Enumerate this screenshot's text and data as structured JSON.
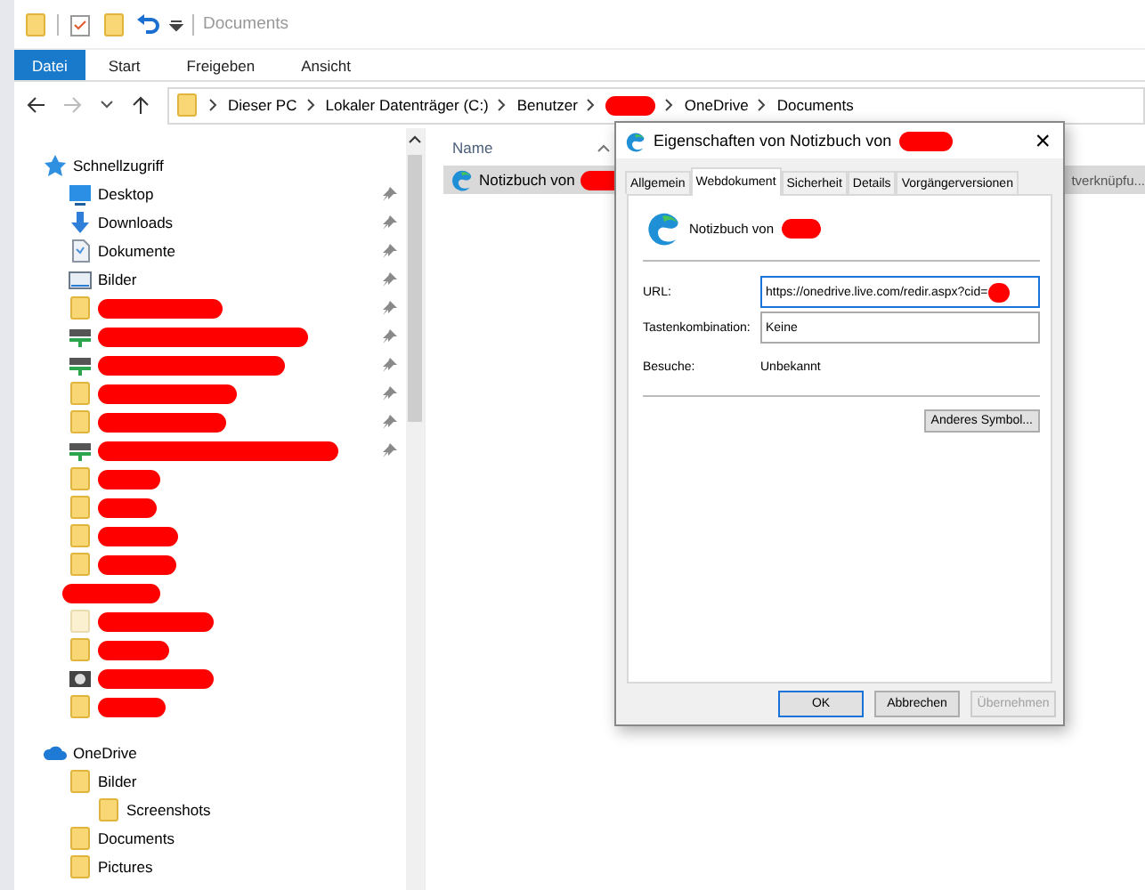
{
  "window": {
    "title": "Documents"
  },
  "ribbon_tabs": [
    {
      "label": "Datei",
      "selected": true
    },
    {
      "label": "Start",
      "selected": false
    },
    {
      "label": "Freigeben",
      "selected": false
    },
    {
      "label": "Ansicht",
      "selected": false
    }
  ],
  "address": {
    "crumbs": [
      {
        "label": "Dieser PC"
      },
      {
        "label": "Lokaler Datenträger (C:)"
      },
      {
        "label": "Benutzer"
      },
      {
        "redacted": true
      },
      {
        "label": "OneDrive"
      },
      {
        "label": "Documents"
      }
    ]
  },
  "nav": {
    "quick_access": {
      "label": "Schnellzugriff",
      "items": [
        {
          "label": "Desktop",
          "kind": "desktop",
          "pinned": true
        },
        {
          "label": "Downloads",
          "kind": "downloads",
          "pinned": true
        },
        {
          "label": "Dokumente",
          "kind": "documents",
          "pinned": true
        },
        {
          "label": "Bilder",
          "kind": "pictures",
          "pinned": true
        },
        {
          "kind": "folder",
          "pinned": true,
          "redacted": true
        },
        {
          "kind": "network",
          "pinned": true,
          "redacted": true
        },
        {
          "kind": "network",
          "pinned": true,
          "redacted": true
        },
        {
          "kind": "folder",
          "pinned": true,
          "redacted": true
        },
        {
          "kind": "folder",
          "pinned": true,
          "redacted": true
        },
        {
          "kind": "network",
          "pinned": true,
          "redacted": true
        },
        {
          "kind": "folder",
          "pinned": false,
          "redacted": true
        },
        {
          "kind": "folder",
          "pinned": false,
          "redacted": true
        },
        {
          "kind": "folder",
          "pinned": false,
          "redacted": true
        },
        {
          "kind": "folder",
          "pinned": false,
          "redacted": true
        },
        {
          "kind": "blank",
          "pinned": false,
          "redacted": true
        },
        {
          "kind": "folder_light",
          "pinned": false,
          "redacted": true
        },
        {
          "kind": "folder",
          "pinned": false,
          "redacted": true
        },
        {
          "kind": "camera",
          "pinned": false,
          "redacted": true
        },
        {
          "kind": "folder",
          "pinned": false,
          "redacted": true
        }
      ]
    },
    "onedrive": {
      "label": "OneDrive",
      "children": [
        {
          "label": "Bilder",
          "children": [
            {
              "label": "Screenshots"
            }
          ]
        },
        {
          "label": "Documents"
        },
        {
          "label": "Pictures"
        }
      ]
    }
  },
  "file_list": {
    "columns": [
      {
        "label": "Name"
      }
    ],
    "rows": [
      {
        "name": "Notizbuch von",
        "redacted": true,
        "selected": true,
        "column_2": "tverknüpfu..."
      }
    ]
  },
  "dialog": {
    "title": "Eigenschaften von Notizbuch von",
    "title_redacted": true,
    "close": "×",
    "tabs": [
      {
        "label": "Allgemein",
        "selected": false
      },
      {
        "label": "Webdokument",
        "selected": true
      },
      {
        "label": "Sicherheit",
        "selected": false
      },
      {
        "label": "Details",
        "selected": false
      },
      {
        "label": "Vorgängerversionen",
        "selected": false
      }
    ],
    "item_name": "Notizbuch von",
    "item_name_redacted": true,
    "fields": [
      {
        "label": "URL:",
        "value": "https://onedrive.live.com/redir.aspx?cid=",
        "redacted": true,
        "focused": true
      },
      {
        "label": "Tastenkombination:",
        "value": "Keine",
        "redacted": false,
        "focused": false
      }
    ],
    "visits": {
      "label": "Besuche:",
      "value": "Unbekannt"
    },
    "change_icon_button": "Anderes Symbol...",
    "buttons": [
      {
        "label": "OK",
        "default": true,
        "disabled": false
      },
      {
        "label": "Abbrechen",
        "default": false,
        "disabled": false
      },
      {
        "label": "Übernehmen",
        "default": false,
        "disabled": true
      }
    ]
  }
}
